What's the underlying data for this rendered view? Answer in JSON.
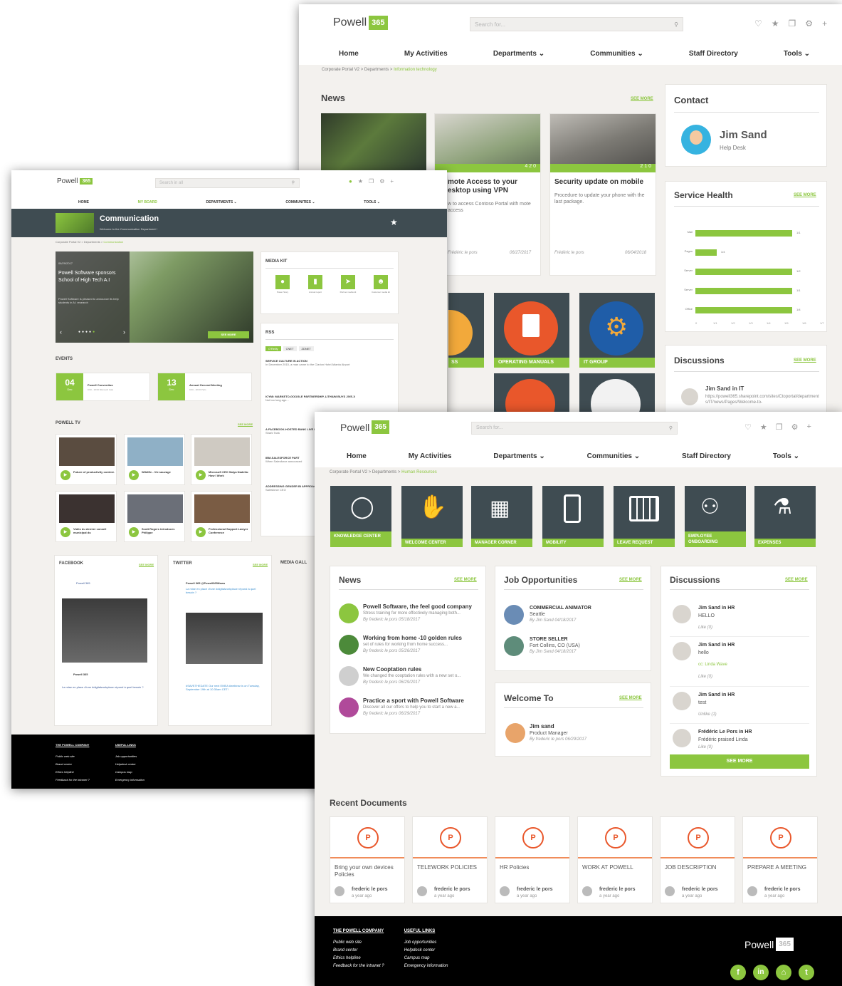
{
  "brand": {
    "name": "Powell",
    "number": "365"
  },
  "screen1": {
    "search_placeholder": "Search for...",
    "nav": [
      "Home",
      "My Activities",
      "Departments ⌄",
      "Communities ⌄",
      "Staff Directory",
      "Tools ⌄"
    ],
    "breadcrumb": "Corporate Portal V2 > Departments > ",
    "breadcrumb_current": "Information technology",
    "news_title": "News",
    "see_more": "SEE MORE",
    "news": [
      {
        "title": "mote Access to your esktop using VPN",
        "text": "w to access Contoso Portal with mote access",
        "author": "Frédéric le pors",
        "date": "06/27/2017",
        "stats": "4  2  0"
      },
      {
        "title": "Security update on mobile",
        "text": "Procedure to update your phone with the last package.",
        "author": "Frédéric le pors",
        "date": "06/04/2018",
        "stats": "2  1  0"
      }
    ],
    "tiles": [
      "SS",
      "OPERATING MANUALS",
      "IT GROUP"
    ],
    "contact_title": "Contact",
    "contact_name": "Jim Sand",
    "contact_role": "Help Desk",
    "health_title": "Service Health",
    "health_rows": [
      {
        "label": "Mail",
        "value": "1/1"
      },
      {
        "label": "Pages",
        "value": "1/4"
      },
      {
        "label": "Server",
        "value": "1/2"
      },
      {
        "label": "Server",
        "value": "1/1"
      },
      {
        "label": "Office",
        "value": "1/4"
      }
    ],
    "health_values": [
      100,
      22,
      100,
      100,
      100
    ],
    "health_axis": [
      "0",
      "1/1",
      "1/2",
      "1/3",
      "1/4",
      "1/5",
      "1/6",
      "1/7"
    ],
    "disc_title": "Discussions",
    "disc_name": "Jim Sand in IT",
    "disc_text": "https://powell365.sharepoint.com/sites/Ctoportal/departments/IT/news/Pages/Welcome-to-"
  },
  "screen2": {
    "search_placeholder": "Search in all",
    "nav": [
      "HOME",
      "MY BOARD",
      "DEPARTMENTS ⌄",
      "COMMUNITIES ⌄",
      "TOOLS ⌄"
    ],
    "banner_title": "Communication",
    "banner_sub": "Welcome to the Communication Department !",
    "breadcrumb": "Corporate Portal V2 > Departments > ",
    "breadcrumb_current": "Communication",
    "hero_date": "06/29/2017",
    "hero_title": "Powell Software sponsors School of High Tech A.I",
    "hero_text": "Powell Software is pleased to announce its help students in A.I research",
    "hero_btn": "SEE MORE",
    "mediakit_title": "MEDIA KIT",
    "mediakit": [
      "Power Story",
      "Annual report",
      "Partner media kit",
      "Customer media kit"
    ],
    "rss_title": "RSS",
    "rss_tabs": [
      "O'Reilly",
      "CNET",
      "ZDNET"
    ],
    "rss_items": [
      {
        "t": "SERVICE CULTURE IN ACTION",
        "d": "In December 2015, a man came to the Clarion Hotel Atlanta Airport"
      },
      {
        "t": "ICYMI: MARKETO-GOOGLE PARTNERSHIP, LITHIUM BUYS JIVE-X",
        "d": "Not too long ago..."
      },
      {
        "t": "A FACEBOOK-HOSTED BANK LIVE PITCH",
        "d": "Shark Tank"
      },
      {
        "t": "IBM-SALESFORCE PART",
        "d": "When Salesforce announced"
      },
      {
        "t": "ADDRESSING GENDER BI APPROACH",
        "d": "Salesforce CEO"
      }
    ],
    "events_title": "EVENTS",
    "events": [
      {
        "day": "04",
        "mon": "Dec",
        "name": "Powell Convention",
        "meta": "9:00 - 18:00   Microsoft Cafe"
      },
      {
        "day": "13",
        "mon": "Dec",
        "name": "Annual General Meeting",
        "meta": "9:00 - 18:00   Paris"
      }
    ],
    "tv_title": "POWELL TV",
    "see_more": "SEE MORE",
    "tv": [
      "Future of productivity contest.",
      "Wildlife - Vie sauvage",
      "Microsoft CEO Satya Nadella: How I Work",
      "Vidéo du dernier conseil municipal du",
      "Scott Rogers introduces Philippe",
      "Professional Support Lawyer Conference"
    ],
    "facebook_title": "FACEBOOK",
    "twitter_title": "TWITTER",
    "media_title": "MEDIA GALL",
    "fb_page": "Powell 365",
    "fb_post_author": "Powell 365",
    "fb_post_text": "La mise en place d'une #digitalworkplace répond à quel besoin ?",
    "tw_author": "Powell 365 @Powell365News",
    "tw_text": "La mise en place d'une #digitalworkplace répond à quel besoin ?",
    "tw_text2": "#SAVETHEDATE Our next EMEA #webinar is on Tuesday, September 19th at 10:30am CET!",
    "footer_h1": "THE POWELL COMPANY",
    "footer_h2": "USEFUL LINKS",
    "footer_l1": [
      "Public web site",
      "Brand center",
      "Ethics helpline",
      "Feedback for the intranet ?"
    ],
    "footer_l2": [
      "Job opportunities",
      "Helpdesk center",
      "Campus map",
      "Emergency information"
    ]
  },
  "screen3": {
    "search_placeholder": "Search for...",
    "nav": [
      "Home",
      "My Activities",
      "Departments ⌄",
      "Communities ⌄",
      "Staff Directory",
      "Tools ⌄"
    ],
    "breadcrumb": "Corporate Portal V2 > Departments > ",
    "breadcrumb_current": "Human Resources",
    "tiles": [
      "KNOWLEDGE CENTER",
      "WELCOME CENTER",
      "MANAGER CORNER",
      "MOBILITY",
      "LEAVE REQUEST",
      "EMPLOYEE ONBOARDING",
      "EXPENSES"
    ],
    "see_more": "SEE MORE",
    "news_title": "News",
    "news": [
      {
        "t": "Powell Software, the feel good company",
        "d": "Stress training for more effectively managing both...",
        "m": "By frederic le pors   05/18/2017"
      },
      {
        "t": "Working from home -10 golden rules",
        "d": "set of rules for working from home success...",
        "m": "By frederic le pors   05/26/2017"
      },
      {
        "t": "New Cooptation rules",
        "d": "We changed the cooptation rules with a new set o...",
        "m": "By frederic le pors   06/29/2017"
      },
      {
        "t": "Practice a sport with Powell Software",
        "d": "Discover all our offers to help you to start a new a...",
        "m": "By frederic le pors   06/29/2017"
      }
    ],
    "jobs_title": "Job Opportunities",
    "jobs": [
      {
        "t": "COMMERCIAL ANIMATOR",
        "d": "Seattle",
        "m": "By Jim Sand   04/18/2017"
      },
      {
        "t": "STORE SELLER",
        "d": "Fort Collins, CO (USA)",
        "m": "By Jim Sand   04/18/2017"
      }
    ],
    "welcome_title": "Welcome To",
    "welcome_name": "Jim sand",
    "welcome_role": "Product Manager",
    "welcome_meta": "By frederic le pors   06/29/2017",
    "disc_title": "Discussions",
    "disc": [
      {
        "n": "Jim Sand in HR",
        "t": "HELLO",
        "l": "Like (0)"
      },
      {
        "n": "Jim Sand in HR",
        "t": "hello",
        "x": "cc: Linda Wave",
        "l": "Like (0)"
      },
      {
        "n": "Jim Sand in HR",
        "t": "test",
        "l": "Unlike (1)"
      },
      {
        "n": "Frédéric Le Pors in HR",
        "t": "Frédéric praised Linda",
        "l": "Like (0)"
      }
    ],
    "disc_btn": "SEE MORE",
    "docs_title": "Recent Documents",
    "docs": [
      "Bring your own devices Policies",
      "TELEWORK POLICIES",
      "HR Policies",
      "WORK AT POWELL",
      "JOB DESCRIPTION",
      "PREPARE A MEETING"
    ],
    "doc_author": "frederic le pors",
    "doc_when": "a year ago",
    "footer_h1": "THE POWELL COMPANY",
    "footer_h2": "USEFUL LINKS",
    "footer_l1": [
      "Public web site",
      "Brand center",
      "Ethics helpline",
      "Feedback for the intranet ?"
    ],
    "footer_l2": [
      "Job opportunities",
      "Helpdesk center",
      "Campus map",
      "Emergency information"
    ],
    "social": [
      "f",
      "in",
      "⌂",
      "t"
    ]
  },
  "colors": {
    "accent": "#8cc63f",
    "dark": "#3f4c52",
    "orange": "#e9572b"
  }
}
